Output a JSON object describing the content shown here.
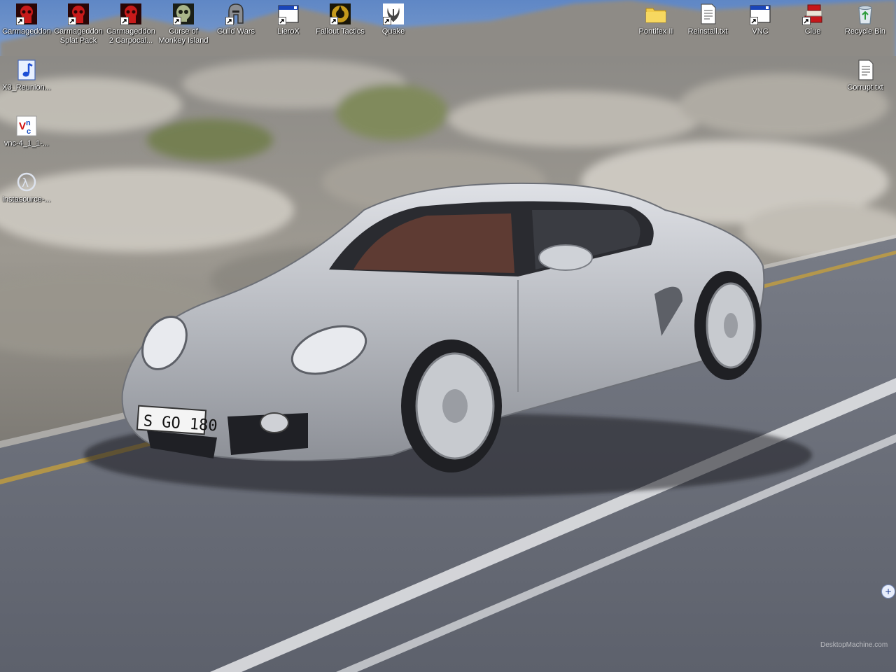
{
  "desktop": {
    "icons": [
      {
        "label": "Carmageddon",
        "icon": "carmageddon-icon",
        "shortcut": true
      },
      {
        "label": "Carmageddon\nSplat Pack",
        "icon": "carmageddon-icon",
        "shortcut": true
      },
      {
        "label": "Carmageddon\n2 Carpocal...",
        "icon": "carmageddon-icon",
        "shortcut": true
      },
      {
        "label": "Curse of\nMonkey Island",
        "icon": "skull-icon",
        "shortcut": true
      },
      {
        "label": "Guild Wars",
        "icon": "helmet-icon",
        "shortcut": true
      },
      {
        "label": "LieroX",
        "icon": "window-icon",
        "shortcut": true
      },
      {
        "label": "Fallout Tactics",
        "icon": "fallout-icon",
        "shortcut": true
      },
      {
        "label": "Quake",
        "icon": "quake-icon",
        "shortcut": true
      },
      {
        "label": "Pontifex II",
        "icon": "folder-icon",
        "shortcut": false
      },
      {
        "label": "Reinstall.txt",
        "icon": "text-file-icon",
        "shortcut": false
      },
      {
        "label": "VNC",
        "icon": "window-icon",
        "shortcut": true
      },
      {
        "label": "Clue",
        "icon": "books-icon",
        "shortcut": true
      },
      {
        "label": "Recycle Bin",
        "icon": "recycle-bin-icon",
        "shortcut": false
      },
      {
        "label": "X3_Reunion...",
        "icon": "music-file-icon",
        "shortcut": false
      },
      {
        "label": "Corrupt.txt",
        "icon": "text-file-icon",
        "shortcut": false
      },
      {
        "label": "vnc-4_1_1-...",
        "icon": "vnc-installer-icon",
        "shortcut": false
      },
      {
        "label": "instasource-...",
        "icon": "half-life-icon",
        "shortcut": false
      }
    ],
    "tray_button_glyph": "+",
    "watermark": "DesktopMachine.com"
  },
  "colors": {
    "sky": "#6f95cc",
    "road": "#6b6f7a",
    "car_silver": "#b9bcc2",
    "icon_label": "#ffffff"
  }
}
